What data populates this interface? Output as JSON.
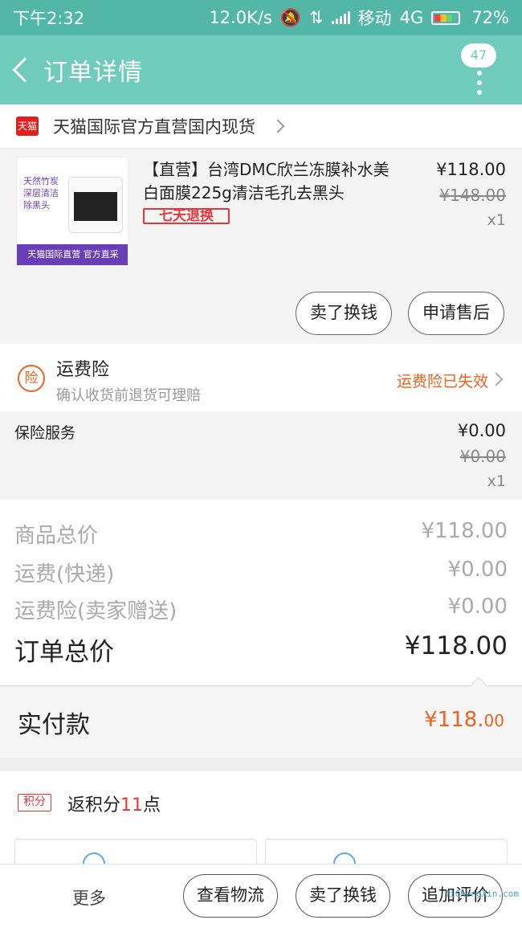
{
  "status_bar": {
    "time": "下午2:32",
    "speed": "12.0K/s",
    "carrier": "移动",
    "network": "4G",
    "battery": "72%"
  },
  "header": {
    "title": "订单详情",
    "badge_count": "47"
  },
  "shop": {
    "logo_text": "天猫",
    "name": "天猫国际官方直营国内现货"
  },
  "product": {
    "image_text": "天然竹炭 深层清洁 除黑头",
    "image_banner": "天猫国际直营 官方直采",
    "title": "【直营】台湾DMC欣兰冻膜补水美白面膜225g清洁毛孔去黑头",
    "tag": "七天退换",
    "price": "¥118.00",
    "original_price": "¥148.00",
    "quantity": "x1",
    "actions": [
      "卖了换钱",
      "申请售后"
    ]
  },
  "insurance": {
    "icon_text": "险",
    "title": "运费险",
    "subtitle": "确认收货前退货可理赔",
    "status": "运费险已失效"
  },
  "service": {
    "label": "保险服务",
    "price": "¥0.00",
    "original_price": "¥0.00",
    "quantity": "x1"
  },
  "summary": {
    "lines": [
      {
        "label": "商品总价",
        "value": "¥118.00"
      },
      {
        "label": "运费(快递)",
        "value": "¥0.00"
      },
      {
        "label": "运费险(卖家赠送)",
        "value": "¥0.00"
      }
    ],
    "total_label": "订单总价",
    "total_value": "¥118.00"
  },
  "payment": {
    "label": "实付款",
    "amount_main": "¥118.",
    "amount_cents": "00"
  },
  "points": {
    "tag": "积分",
    "prefix": "返积分",
    "count": "11",
    "suffix": "点"
  },
  "bottom_bar": {
    "more": "更多",
    "buttons": [
      "查看物流",
      "卖了换钱",
      "追加评价"
    ]
  },
  "watermark": "JiChengXin.com",
  "colors": {
    "status_bar": "#52b7a6",
    "header": "#6fcbbb",
    "accent_orange": "#f0621e",
    "accent_red": "#e4393c",
    "tmall_red": "#e0201e"
  }
}
